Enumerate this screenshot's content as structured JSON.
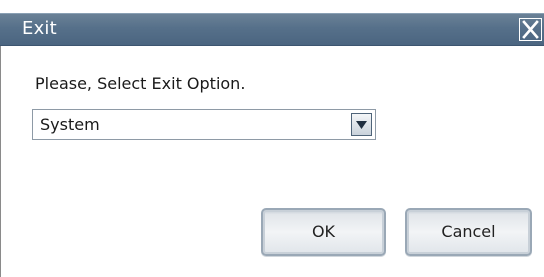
{
  "dialog": {
    "title": "Exit",
    "close_icon": "close-icon"
  },
  "prompt": "Please, Select Exit Option.",
  "exit_option": {
    "selected": "System",
    "arrow_icon": "chevron-down-icon"
  },
  "buttons": {
    "ok": "OK",
    "cancel": "Cancel"
  },
  "colors": {
    "titlebar": "#56708a",
    "title_text": "#ffffff",
    "background": "#ffffff"
  }
}
